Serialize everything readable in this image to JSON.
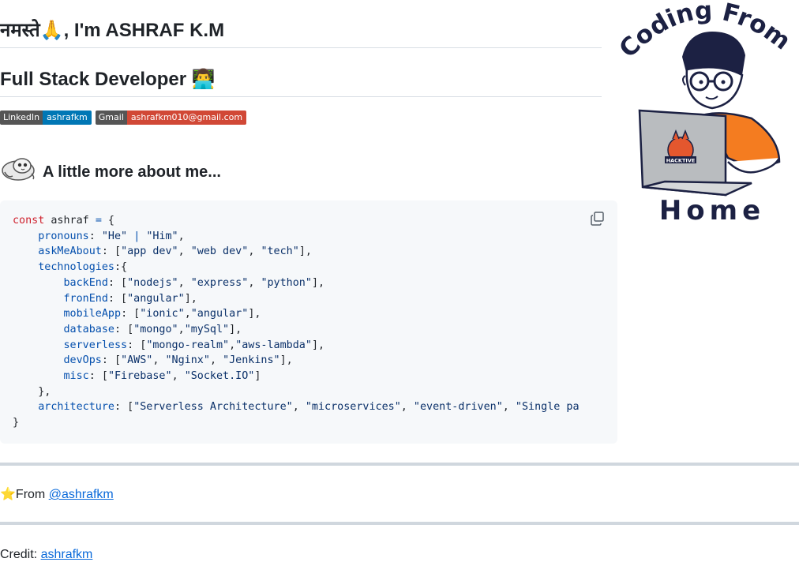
{
  "header": {
    "greeting": "नमस्ते🙏, I'm ASHRAF K.M",
    "role": "Full Stack Developer 👨‍💻"
  },
  "badges": [
    {
      "key": "LinkedIn",
      "value": "ashrafkm",
      "color": "#0077b5"
    },
    {
      "key": "Gmail",
      "value": "ashrafkm010@gmail.com",
      "color": "#d14836"
    }
  ],
  "about": {
    "icon": "octocat-icon",
    "title": "A little more about me..."
  },
  "code": {
    "copy_icon": "copy-icon",
    "lines": [
      "const ashraf = {",
      "    pronouns: \"He\" | \"Him\",",
      "    askMeAbout: [\"app dev\", \"web dev\", \"tech\"],",
      "    technologies:{",
      "        backEnd: [\"nodejs\", \"express\", \"python\"],",
      "        fronEnd: [\"angular\"],",
      "        mobileApp: [\"ionic\",\"angular\"],",
      "        database: [\"mongo\",\"mySql\"],",
      "        serverless: [\"mongo-realm\",\"aws-lambda\"],",
      "        devOps: [\"AWS\", \"Nginx\", \"Jenkins\"],",
      "        misc: [\"Firebase\", \"Socket.IO\"]",
      "    },",
      "    architecture: [\"Serverless Architecture\", \"microservices\", \"event-driven\", \"Single pa",
      "}"
    ]
  },
  "footer": {
    "from_prefix": "⭐From ",
    "from_link": "@ashrafkm",
    "credit_prefix": "Credit: ",
    "credit_link": "ashrafkm"
  },
  "illustration": {
    "top_text": "Coding From",
    "bottom_text": "Home",
    "laptop_logo": "HACKTIVE",
    "shirt_color": "#f47c20"
  }
}
